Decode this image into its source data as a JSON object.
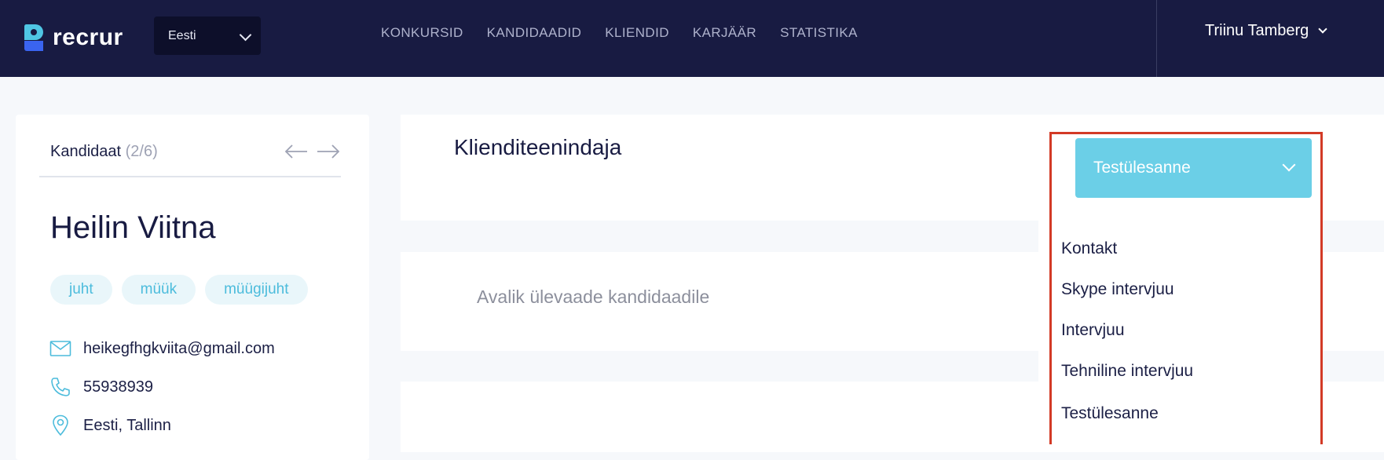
{
  "app": {
    "logo_text": "recrur",
    "language": "Eesti"
  },
  "nav": {
    "items": [
      "KONKURSID",
      "KANDIDAADID",
      "KLIENDID",
      "KARJÄÄR",
      "STATISTIKA"
    ],
    "user_name": "Triinu Tamberg"
  },
  "candidate": {
    "header_label": "Kandidaat",
    "position_counter": "(2/6)",
    "name": "Heilin Viitna",
    "tags": [
      "juht",
      "müük",
      "müügijuht"
    ],
    "email": "heikegfhgkviita@gmail.com",
    "phone": "55938939",
    "location": "Eesti, Tallinn"
  },
  "job": {
    "title": "Klienditeenindaja",
    "public_overview_link": "Avalik ülevaade kandidaadile"
  },
  "status_dropdown": {
    "selected": "Testülesanne",
    "options": [
      "Kontakt",
      "Skype intervjuu",
      "Intervjuu",
      "Tehniline intervjuu",
      "Testülesanne"
    ]
  },
  "colors": {
    "topbar": "#181b42",
    "accent_cyan": "#6bcfe7",
    "tag_text": "#4cbcdc",
    "highlight_outline": "#d33a26"
  }
}
